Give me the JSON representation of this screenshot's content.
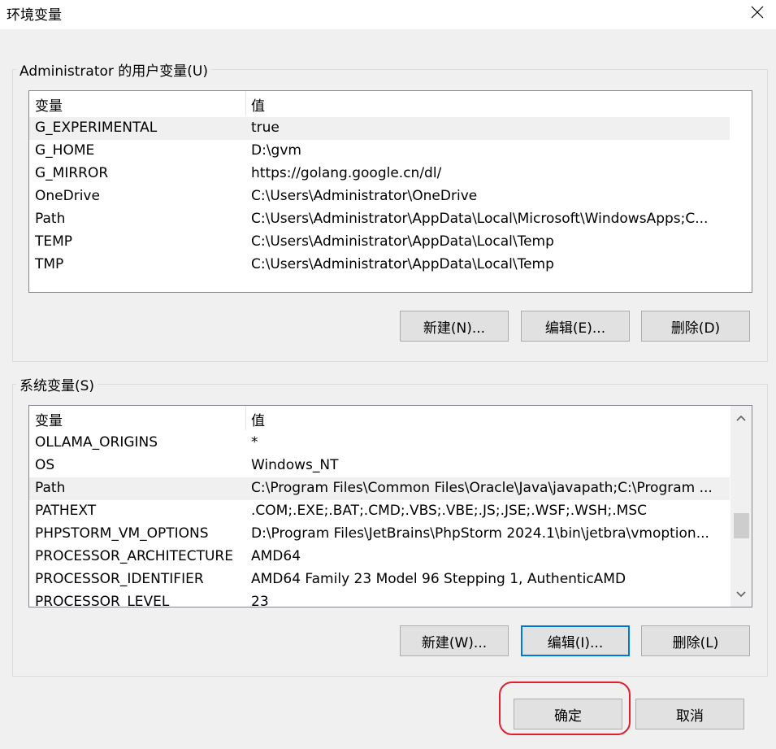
{
  "window": {
    "title": "环境变量"
  },
  "user_vars": {
    "legend": "Administrator 的用户变量(U)",
    "columns": {
      "name": "变量",
      "value": "值"
    },
    "rows": [
      {
        "name": "G_EXPERIMENTAL",
        "value": "true"
      },
      {
        "name": "G_HOME",
        "value": "D:\\gvm"
      },
      {
        "name": "G_MIRROR",
        "value": "https://golang.google.cn/dl/"
      },
      {
        "name": "OneDrive",
        "value": "C:\\Users\\Administrator\\OneDrive"
      },
      {
        "name": "Path",
        "value": "C:\\Users\\Administrator\\AppData\\Local\\Microsoft\\WindowsApps;C..."
      },
      {
        "name": "TEMP",
        "value": "C:\\Users\\Administrator\\AppData\\Local\\Temp"
      },
      {
        "name": "TMP",
        "value": "C:\\Users\\Administrator\\AppData\\Local\\Temp"
      }
    ],
    "selected_index": 0,
    "buttons": {
      "new": "新建(N)...",
      "edit": "编辑(E)...",
      "delete": "删除(D)"
    }
  },
  "system_vars": {
    "legend": "系统变量(S)",
    "columns": {
      "name": "变量",
      "value": "值"
    },
    "rows": [
      {
        "name": "OLLAMA_ORIGINS",
        "value": "*"
      },
      {
        "name": "OS",
        "value": "Windows_NT"
      },
      {
        "name": "Path",
        "value": "C:\\Program Files\\Common Files\\Oracle\\Java\\javapath;C:\\Program ..."
      },
      {
        "name": "PATHEXT",
        "value": ".COM;.EXE;.BAT;.CMD;.VBS;.VBE;.JS;.JSE;.WSF;.WSH;.MSC"
      },
      {
        "name": "PHPSTORM_VM_OPTIONS",
        "value": "D:\\Program Files\\JetBrains\\PhpStorm 2024.1\\bin\\jetbra\\vmoption..."
      },
      {
        "name": "PROCESSOR_ARCHITECTURE",
        "value": "AMD64"
      },
      {
        "name": "PROCESSOR_IDENTIFIER",
        "value": "AMD64 Family 23 Model 96 Stepping 1, AuthenticAMD"
      },
      {
        "name": "PROCESSOR_LEVEL",
        "value": "23"
      }
    ],
    "selected_index": 2,
    "buttons": {
      "new": "新建(W)...",
      "edit": "编辑(I)...",
      "delete": "删除(L)"
    }
  },
  "footer": {
    "ok": "确定",
    "cancel": "取消"
  }
}
